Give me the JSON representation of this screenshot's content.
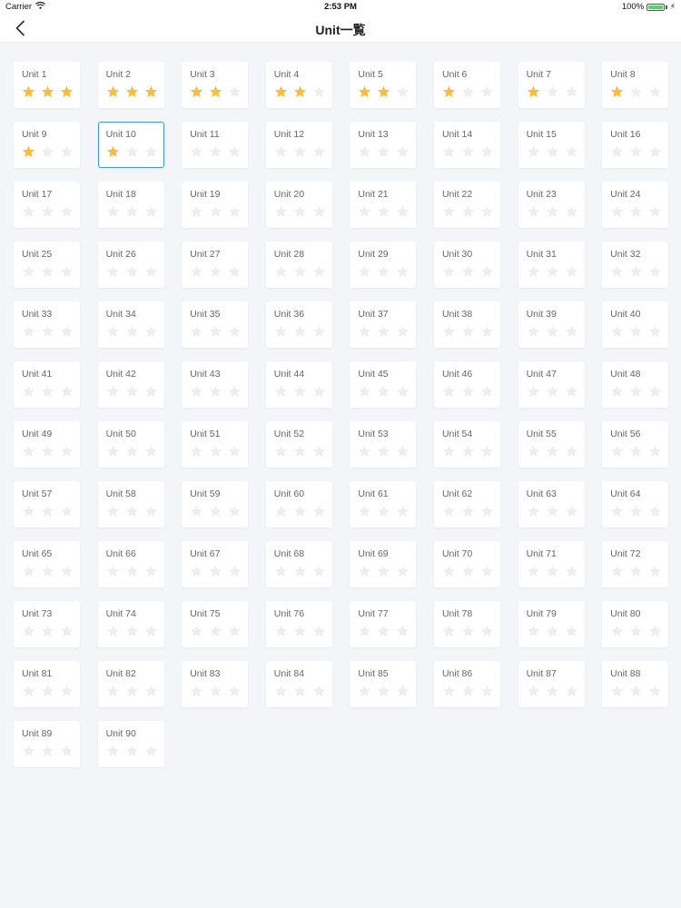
{
  "status_bar": {
    "carrier": "Carrier",
    "time": "2:53 PM",
    "battery_text": "100%",
    "battery_level": 1.0
  },
  "nav": {
    "title": "Unit一覧",
    "back_icon": "chevron-left-icon"
  },
  "colors": {
    "star_filled": "#f7bd42",
    "star_empty": "#eeeeee",
    "selected_border": "#3b9bd6"
  },
  "units": [
    {
      "label": "Unit 1",
      "stars": 3
    },
    {
      "label": "Unit 2",
      "stars": 3
    },
    {
      "label": "Unit 3",
      "stars": 2
    },
    {
      "label": "Unit 4",
      "stars": 2
    },
    {
      "label": "Unit 5",
      "stars": 2
    },
    {
      "label": "Unit 6",
      "stars": 1
    },
    {
      "label": "Unit 7",
      "stars": 1
    },
    {
      "label": "Unit 8",
      "stars": 1
    },
    {
      "label": "Unit 9",
      "stars": 1
    },
    {
      "label": "Unit 10",
      "stars": 1,
      "selected": true
    },
    {
      "label": "Unit 11",
      "stars": 0
    },
    {
      "label": "Unit 12",
      "stars": 0
    },
    {
      "label": "Unit 13",
      "stars": 0
    },
    {
      "label": "Unit 14",
      "stars": 0
    },
    {
      "label": "Unit 15",
      "stars": 0
    },
    {
      "label": "Unit 16",
      "stars": 0
    },
    {
      "label": "Unit 17",
      "stars": 0
    },
    {
      "label": "Unit 18",
      "stars": 0
    },
    {
      "label": "Unit 19",
      "stars": 0
    },
    {
      "label": "Unit 20",
      "stars": 0
    },
    {
      "label": "Unit 21",
      "stars": 0
    },
    {
      "label": "Unit 22",
      "stars": 0
    },
    {
      "label": "Unit 23",
      "stars": 0
    },
    {
      "label": "Unit 24",
      "stars": 0
    },
    {
      "label": "Unit 25",
      "stars": 0
    },
    {
      "label": "Unit 26",
      "stars": 0
    },
    {
      "label": "Unit 27",
      "stars": 0
    },
    {
      "label": "Unit 28",
      "stars": 0
    },
    {
      "label": "Unit 29",
      "stars": 0
    },
    {
      "label": "Unit 30",
      "stars": 0
    },
    {
      "label": "Unit 31",
      "stars": 0
    },
    {
      "label": "Unit 32",
      "stars": 0
    },
    {
      "label": "Unit 33",
      "stars": 0
    },
    {
      "label": "Unit 34",
      "stars": 0
    },
    {
      "label": "Unit 35",
      "stars": 0
    },
    {
      "label": "Unit 36",
      "stars": 0
    },
    {
      "label": "Unit 37",
      "stars": 0
    },
    {
      "label": "Unit 38",
      "stars": 0
    },
    {
      "label": "Unit 39",
      "stars": 0
    },
    {
      "label": "Unit 40",
      "stars": 0
    },
    {
      "label": "Unit 41",
      "stars": 0
    },
    {
      "label": "Unit 42",
      "stars": 0
    },
    {
      "label": "Unit 43",
      "stars": 0
    },
    {
      "label": "Unit 44",
      "stars": 0
    },
    {
      "label": "Unit 45",
      "stars": 0
    },
    {
      "label": "Unit 46",
      "stars": 0
    },
    {
      "label": "Unit 47",
      "stars": 0
    },
    {
      "label": "Unit 48",
      "stars": 0
    },
    {
      "label": "Unit 49",
      "stars": 0
    },
    {
      "label": "Unit 50",
      "stars": 0
    },
    {
      "label": "Unit 51",
      "stars": 0
    },
    {
      "label": "Unit 52",
      "stars": 0
    },
    {
      "label": "Unit 53",
      "stars": 0
    },
    {
      "label": "Unit 54",
      "stars": 0
    },
    {
      "label": "Unit 55",
      "stars": 0
    },
    {
      "label": "Unit 56",
      "stars": 0
    },
    {
      "label": "Unit 57",
      "stars": 0
    },
    {
      "label": "Unit 58",
      "stars": 0
    },
    {
      "label": "Unit 59",
      "stars": 0
    },
    {
      "label": "Unit 60",
      "stars": 0
    },
    {
      "label": "Unit 61",
      "stars": 0
    },
    {
      "label": "Unit 62",
      "stars": 0
    },
    {
      "label": "Unit 63",
      "stars": 0
    },
    {
      "label": "Unit 64",
      "stars": 0
    },
    {
      "label": "Unit 65",
      "stars": 0
    },
    {
      "label": "Unit 66",
      "stars": 0
    },
    {
      "label": "Unit 67",
      "stars": 0
    },
    {
      "label": "Unit 68",
      "stars": 0
    },
    {
      "label": "Unit 69",
      "stars": 0
    },
    {
      "label": "Unit 70",
      "stars": 0
    },
    {
      "label": "Unit 71",
      "stars": 0
    },
    {
      "label": "Unit 72",
      "stars": 0
    },
    {
      "label": "Unit 73",
      "stars": 0
    },
    {
      "label": "Unit 74",
      "stars": 0
    },
    {
      "label": "Unit 75",
      "stars": 0
    },
    {
      "label": "Unit 76",
      "stars": 0
    },
    {
      "label": "Unit 77",
      "stars": 0
    },
    {
      "label": "Unit 78",
      "stars": 0
    },
    {
      "label": "Unit 79",
      "stars": 0
    },
    {
      "label": "Unit 80",
      "stars": 0
    },
    {
      "label": "Unit 81",
      "stars": 0
    },
    {
      "label": "Unit 82",
      "stars": 0
    },
    {
      "label": "Unit 83",
      "stars": 0
    },
    {
      "label": "Unit 84",
      "stars": 0
    },
    {
      "label": "Unit 85",
      "stars": 0
    },
    {
      "label": "Unit 86",
      "stars": 0
    },
    {
      "label": "Unit 87",
      "stars": 0
    },
    {
      "label": "Unit 88",
      "stars": 0
    },
    {
      "label": "Unit 89",
      "stars": 0
    },
    {
      "label": "Unit 90",
      "stars": 0
    }
  ]
}
